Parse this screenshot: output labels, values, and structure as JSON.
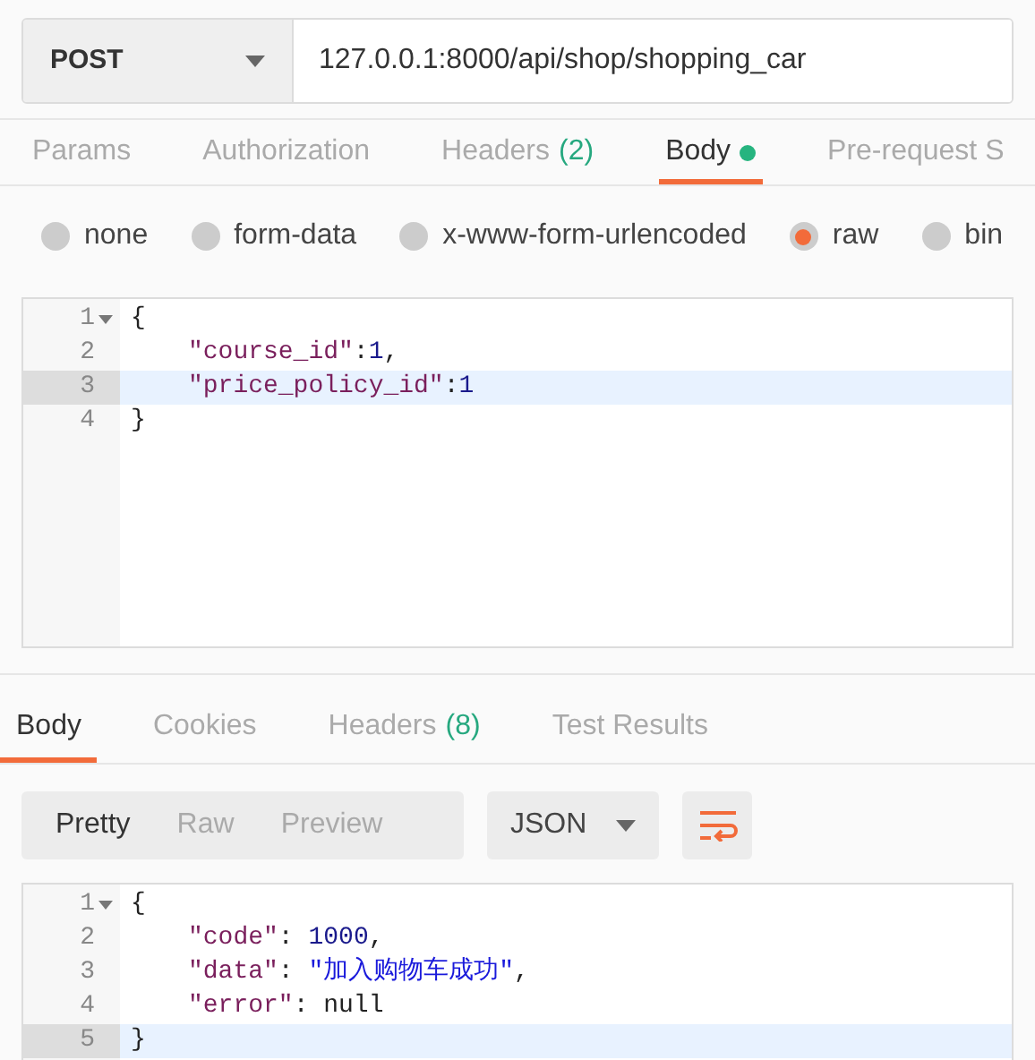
{
  "request": {
    "method": "POST",
    "url": "127.0.0.1:8000/api/shop/shopping_car"
  },
  "request_tabs": [
    {
      "label": "Params",
      "selected": false
    },
    {
      "label": "Authorization",
      "selected": false
    },
    {
      "label": "Headers",
      "count": "(2)",
      "selected": false
    },
    {
      "label": "Body",
      "selected": true,
      "dot": true
    },
    {
      "label": "Pre-request S",
      "selected": false
    }
  ],
  "body_types": [
    {
      "label": "none",
      "selected": false
    },
    {
      "label": "form-data",
      "selected": false
    },
    {
      "label": "x-www-form-urlencoded",
      "selected": false
    },
    {
      "label": "raw",
      "selected": true
    },
    {
      "label": "bin",
      "selected": false
    }
  ],
  "request_editor": {
    "lines": [
      {
        "number": "1",
        "foldable": true,
        "active": false,
        "indented": false,
        "tokens": [
          {
            "kind": "punct",
            "text": "{"
          }
        ]
      },
      {
        "number": "2",
        "foldable": false,
        "active": false,
        "indented": true,
        "tokens": [
          {
            "kind": "key",
            "text": "\"course_id\""
          },
          {
            "kind": "punct",
            "text": ":"
          },
          {
            "kind": "number",
            "text": "1"
          },
          {
            "kind": "punct",
            "text": ","
          }
        ]
      },
      {
        "number": "3",
        "foldable": false,
        "active": true,
        "indented": true,
        "tokens": [
          {
            "kind": "key",
            "text": "\"price_policy_id\""
          },
          {
            "kind": "punct",
            "text": ":"
          },
          {
            "kind": "number",
            "text": "1"
          }
        ]
      },
      {
        "number": "4",
        "foldable": false,
        "active": false,
        "indented": false,
        "tokens": [
          {
            "kind": "punct",
            "text": "}"
          }
        ]
      }
    ]
  },
  "response_tabs": [
    {
      "label": "Body",
      "selected": true
    },
    {
      "label": "Cookies",
      "selected": false
    },
    {
      "label": "Headers",
      "count": "(8)",
      "selected": false
    },
    {
      "label": "Test Results",
      "selected": false
    }
  ],
  "view_modes": [
    {
      "label": "Pretty",
      "selected": true
    },
    {
      "label": "Raw",
      "selected": false
    },
    {
      "label": "Preview",
      "selected": false
    }
  ],
  "format_select": {
    "value": "JSON"
  },
  "response_editor": {
    "lines": [
      {
        "number": "1",
        "foldable": true,
        "active": false,
        "indented": false,
        "tokens": [
          {
            "kind": "punct",
            "text": "{"
          }
        ]
      },
      {
        "number": "2",
        "foldable": false,
        "active": false,
        "indented": true,
        "tokens": [
          {
            "kind": "key",
            "text": "\"code\""
          },
          {
            "kind": "punct",
            "text": ": "
          },
          {
            "kind": "number",
            "text": "1000"
          },
          {
            "kind": "punct",
            "text": ","
          }
        ]
      },
      {
        "number": "3",
        "foldable": false,
        "active": false,
        "indented": true,
        "tokens": [
          {
            "kind": "key",
            "text": "\"data\""
          },
          {
            "kind": "punct",
            "text": ": "
          },
          {
            "kind": "string",
            "text": "\"加入购物车成功\""
          },
          {
            "kind": "punct",
            "text": ","
          }
        ]
      },
      {
        "number": "4",
        "foldable": false,
        "active": false,
        "indented": true,
        "tokens": [
          {
            "kind": "key",
            "text": "\"error\""
          },
          {
            "kind": "punct",
            "text": ": "
          },
          {
            "kind": "keyword",
            "text": "null"
          }
        ]
      },
      {
        "number": "5",
        "foldable": false,
        "active": true,
        "indented": false,
        "tokens": [
          {
            "kind": "punct",
            "text": "}"
          }
        ]
      }
    ]
  }
}
